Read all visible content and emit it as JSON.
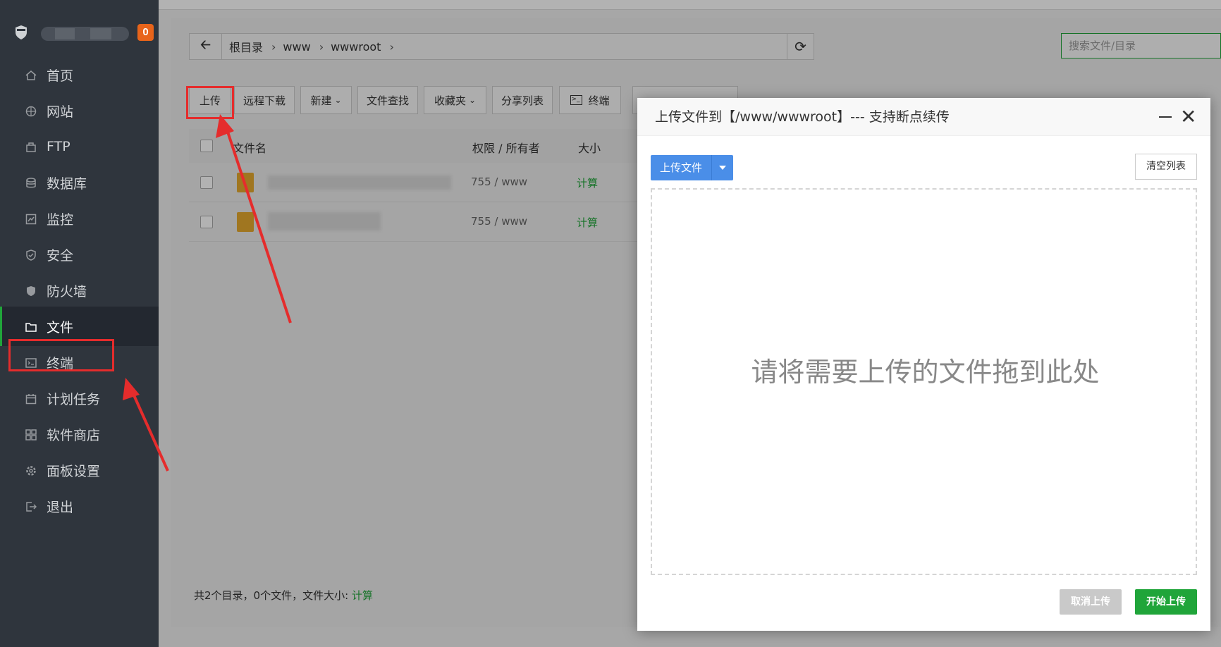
{
  "sidebar": {
    "badge": "0",
    "items": [
      {
        "label": "首页",
        "icon": "home-icon"
      },
      {
        "label": "网站",
        "icon": "globe-icon"
      },
      {
        "label": "FTP",
        "icon": "ftp-icon"
      },
      {
        "label": "数据库",
        "icon": "database-icon"
      },
      {
        "label": "监控",
        "icon": "monitor-icon"
      },
      {
        "label": "安全",
        "icon": "shield-icon"
      },
      {
        "label": "防火墙",
        "icon": "firewall-icon"
      },
      {
        "label": "文件",
        "icon": "folder-icon"
      },
      {
        "label": "终端",
        "icon": "terminal-icon"
      },
      {
        "label": "计划任务",
        "icon": "calendar-icon"
      },
      {
        "label": "软件商店",
        "icon": "apps-icon"
      },
      {
        "label": "面板设置",
        "icon": "gear-icon"
      },
      {
        "label": "退出",
        "icon": "logout-icon"
      }
    ]
  },
  "breadcrumb": {
    "root": "根目录",
    "seg1": "www",
    "seg2": "wwwroot"
  },
  "search": {
    "placeholder": "搜索文件/目录"
  },
  "toolbar": {
    "upload": "上传",
    "remote_download": "远程下载",
    "new": "新建",
    "find": "文件查找",
    "favorites": "收藏夹",
    "share_list": "分享列表",
    "terminal": "终端"
  },
  "table": {
    "headers": {
      "name": "文件名",
      "perm": "权限 / 所有者",
      "size": "大小"
    },
    "rows": [
      {
        "perm": "755 / www",
        "size": "计算"
      },
      {
        "perm": "755 / www",
        "size": "计算"
      }
    ]
  },
  "footer": {
    "summary": "共2个目录，0个文件，文件大小:",
    "calc": "计算"
  },
  "modal": {
    "title": "上传文件到【/www/wwwroot】--- 支持断点续传",
    "upload_file": "上传文件",
    "clear_list": "清空列表",
    "drop_hint": "请将需要上传的文件拖到此处",
    "cancel": "取消上传",
    "start": "开始上传"
  },
  "colors": {
    "sidebar_bg": "#2f353d",
    "accent_green": "#20a53a",
    "upload_blue": "#4a8ee8",
    "annotation_red": "#e52c2c"
  }
}
